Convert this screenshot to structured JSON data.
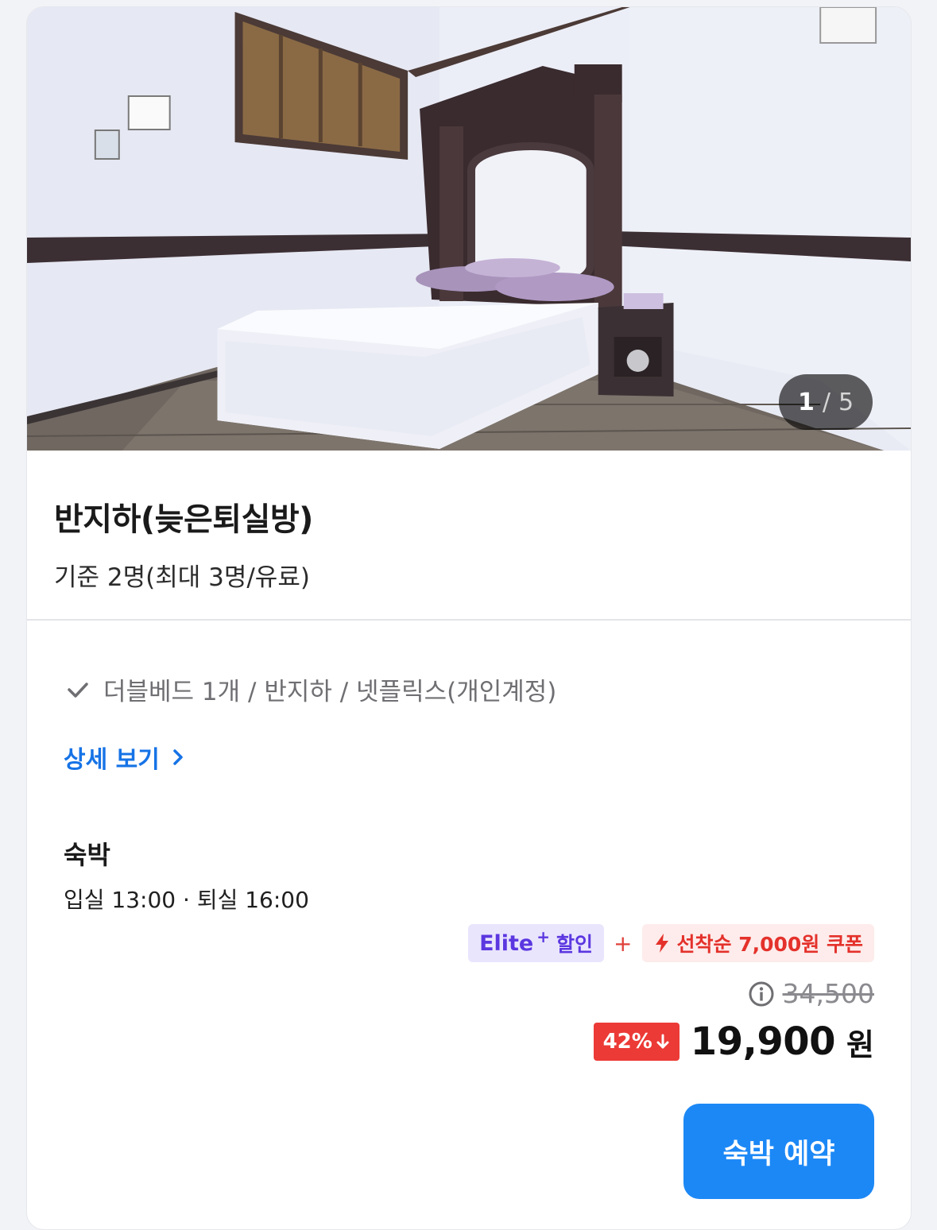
{
  "gallery": {
    "current": "1",
    "separator": "/",
    "total": "5"
  },
  "room": {
    "title": "반지하(늦은퇴실방)",
    "capacity": "기준 2명(최대 3명/유료)"
  },
  "amenities": {
    "text": "더블베드 1개 / 반지하 / 넷플릭스(개인계정)"
  },
  "detail_link": {
    "label": "상세 보기"
  },
  "stay": {
    "title": "숙박",
    "times": "입실 13:00 · 퇴실 16:00"
  },
  "badges": {
    "elite_word": "Elite",
    "elite_plus": "+",
    "elite_discount": "할인",
    "separator": "+",
    "coupon": "선착순 7,000원 쿠폰"
  },
  "price": {
    "original": "34,500",
    "discount_rate": "42%",
    "final": "19,900",
    "unit": "원"
  },
  "reserve_button": {
    "label": "숙박 예약"
  },
  "colors": {
    "accent_blue": "#1c88f6",
    "link_blue": "#1673e6",
    "discount_red": "#ec3a36",
    "elite_purple": "#5b37e0"
  }
}
